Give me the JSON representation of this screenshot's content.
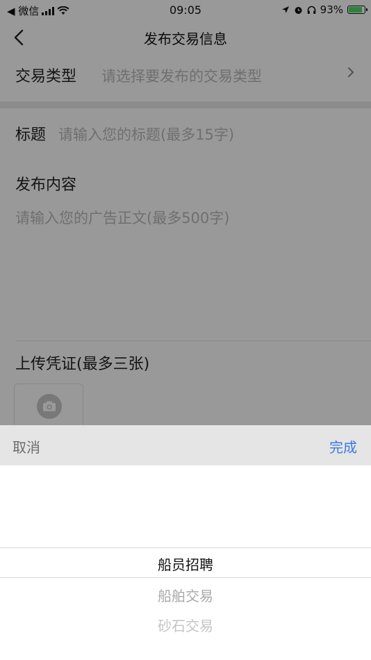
{
  "status_bar": {
    "back_app": "◀ 微信",
    "time": "09:05",
    "battery_percent_text": "93%",
    "battery_level": 0.93
  },
  "nav": {
    "title": "发布交易信息"
  },
  "form": {
    "type_label": "交易类型",
    "type_placeholder": "请选择要发布的交易类型",
    "title_label": "标题",
    "title_placeholder": "请输入您的标题(最多15字)",
    "content_label": "发布内容",
    "content_placeholder": "请输入您的广告正文(最多500字)",
    "upload_label": "上传凭证(最多三张)"
  },
  "picker": {
    "cancel_label": "取消",
    "done_label": "完成",
    "options": [
      "船员招聘",
      "船舶交易",
      "砂石交易"
    ],
    "selected_index": 0
  },
  "colors": {
    "accent": "#3a7ae6",
    "placeholder": "#b9b9b9",
    "battery_fill": "#4cd964"
  }
}
